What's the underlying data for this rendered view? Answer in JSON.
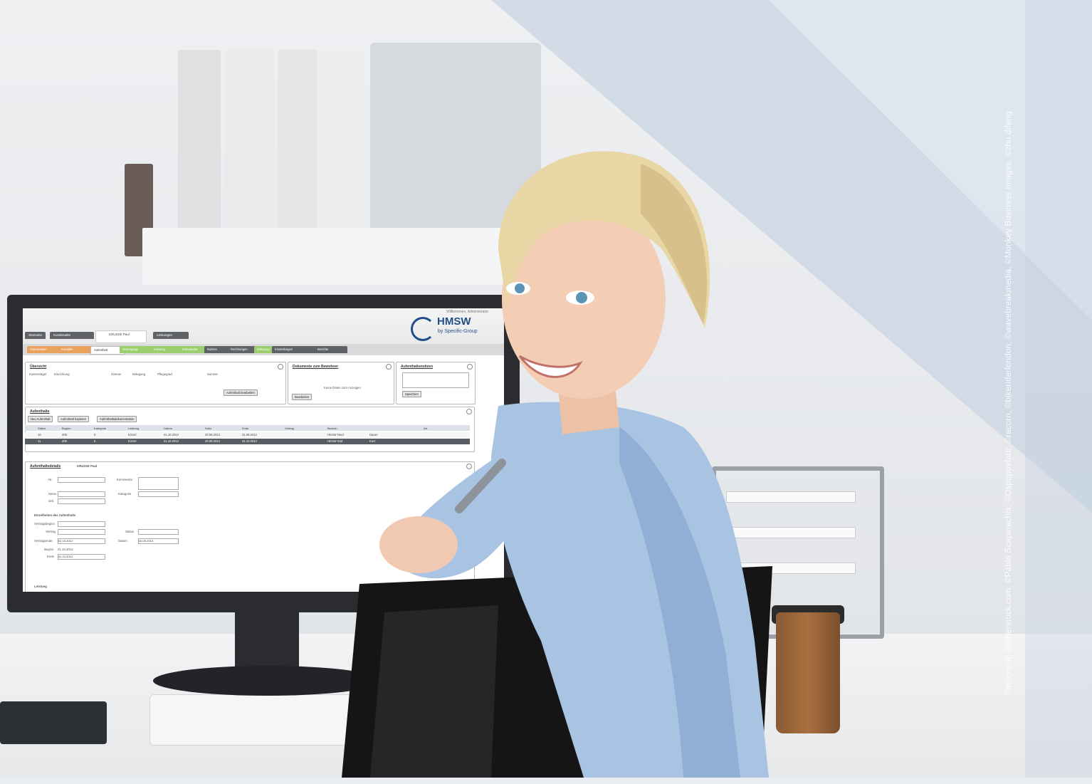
{
  "photo_credit": "Fotocredit: shutterstock.com: ©Pablo Scapinachis, ©Ospopovfoto, ©racorn, ©bikeriderlondon, ©wavebreakmedia, ©Monkey Business Images, ©zhu difeng",
  "screen": {
    "logo": {
      "name": "HMSW",
      "tagline": "by Specific-Group"
    },
    "login_status": "Willkommen, Administrator",
    "top_tabs": [
      "Startseite",
      "Kundenakte"
    ],
    "patient_tab": {
      "name": "KRUSSE Paul",
      "sub": ""
    },
    "top_tab_right": "Leistungen",
    "nav_tabs": [
      {
        "label": "Stammdaten",
        "color": "#e8a25c"
      },
      {
        "label": "Kontakte",
        "color": "#e8a25c"
      },
      {
        "label": "Aufenthalt",
        "color": "#ffffff"
      },
      {
        "label": "Versorgung",
        "color": "#9bcf6e"
      },
      {
        "label": "Leistung",
        "color": "#9bcf6e"
      },
      {
        "label": "Dokumente",
        "color": "#9bcf6e"
      },
      {
        "label": "Notizen",
        "color": "#5f6368"
      },
      {
        "label": "Rechnungen",
        "color": "#5f6368"
      },
      {
        "label": "Belegung",
        "color": "#9bcf6e"
      },
      {
        "label": "Einstellungen",
        "color": "#5f6368"
      },
      {
        "label": "Berichte",
        "color": "#5f6368"
      }
    ],
    "overview_panel": {
      "title": "Übersicht",
      "fields": [
        "Kostenträger",
        "Einrichtung",
        "Zimmer",
        "Belegung",
        "Pflegegrad",
        "Summe"
      ],
      "button": "Aufenthalt bearbeiten"
    },
    "docs_panel": {
      "title": "Dokumente zum Bewohner",
      "empty_text": "Keine Daten zum Anzeigen",
      "button": "Bearbeiten"
    },
    "notes_panel": {
      "title": "Aufenthaltsnotizen",
      "button": "Speichern"
    },
    "grid_panel": {
      "title": "Aufenthalte",
      "buttons": [
        "Neu Aufenthalt",
        "Aufenthalt kopieren",
        "Aufenthaltsdokumentation"
      ],
      "columns": [
        "Status",
        "Beginn",
        "Kategorie",
        "Leistung",
        "Datum",
        "Notiz",
        "Ende",
        "Vertrag",
        "Bereich",
        "Art"
      ],
      "rows": [
        {
          "status": "10",
          "code": "406",
          "cat": "5",
          "kind": "Einzel",
          "d1": "01.10.2012",
          "d2": "30.09.2012",
          "d3": "31.09.2012",
          "org": "HKSW Nord",
          "type": "Dauer"
        },
        {
          "status": "11",
          "code": "405",
          "cat": "5",
          "kind": "Einzel",
          "d1": "01.10.2012",
          "d2": "30.09.2012",
          "d3": "31.10.2012",
          "org": "HKSW Süd",
          "type": "Kurz"
        }
      ]
    },
    "detail_panel": {
      "title": "Aufenthaltsdetails",
      "patient": "KRUSSE Paul",
      "labels": [
        "Nr.",
        "Name",
        "Zeit",
        "Kommentar",
        "Kategorie"
      ],
      "section": "Einzelheiten des Aufenthalts",
      "form_labels": [
        "Vertragsbeginn",
        "Vertrag",
        "Vertragsende",
        "Beginn",
        "Ende",
        "Status",
        "Datum"
      ],
      "values": [
        "01.10.2012",
        "30.09.2013",
        "01.10.2012",
        "01.10.2012"
      ],
      "footer": "Leistung"
    }
  }
}
